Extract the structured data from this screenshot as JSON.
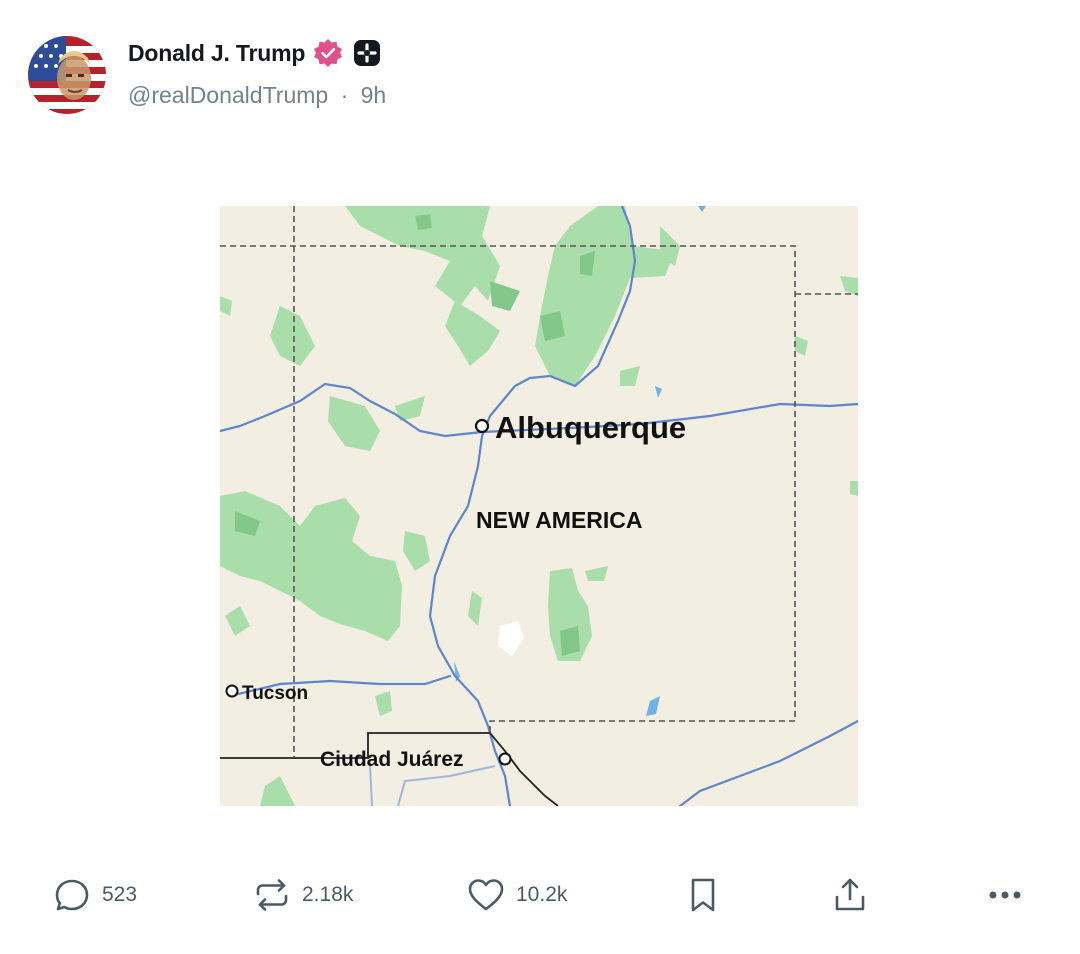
{
  "post": {
    "display_name": "Donald J. Trump",
    "handle": "@realDonaldTrump",
    "separator": "·",
    "time": "9h",
    "badges": [
      "verified-badge-icon",
      "plus-badge-icon"
    ]
  },
  "map": {
    "labels": {
      "albuquerque": "Albuquerque",
      "region": "NEW AMERICA",
      "tucson": "Tucson",
      "juarez": "Ciudad Juárez"
    },
    "colors": {
      "land": "#f2eee2",
      "forest": "#a9ddaa",
      "forest_dark": "#83c88a",
      "river": "#5d86cc",
      "border": "#555555"
    }
  },
  "actions": {
    "replies": "523",
    "reposts": "2.18k",
    "likes": "10.2k"
  },
  "icons": {
    "reply": "reply-icon",
    "repost": "repost-icon",
    "like": "heart-icon",
    "bookmark": "bookmark-icon",
    "share": "share-icon",
    "more": "more-icon"
  }
}
